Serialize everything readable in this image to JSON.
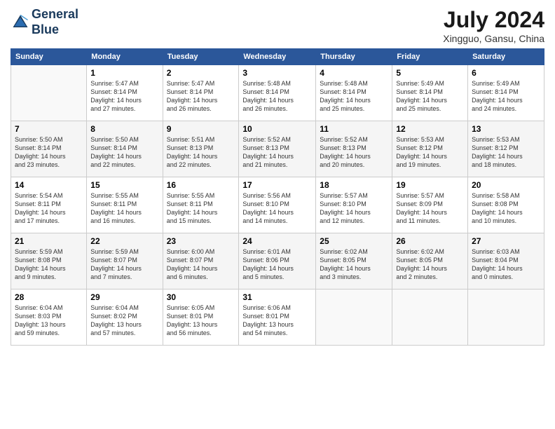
{
  "header": {
    "logo_line1": "General",
    "logo_line2": "Blue",
    "month_title": "July 2024",
    "location": "Xingguo, Gansu, China"
  },
  "weekdays": [
    "Sunday",
    "Monday",
    "Tuesday",
    "Wednesday",
    "Thursday",
    "Friday",
    "Saturday"
  ],
  "weeks": [
    [
      {
        "day": "",
        "info": ""
      },
      {
        "day": "1",
        "info": "Sunrise: 5:47 AM\nSunset: 8:14 PM\nDaylight: 14 hours\nand 27 minutes."
      },
      {
        "day": "2",
        "info": "Sunrise: 5:47 AM\nSunset: 8:14 PM\nDaylight: 14 hours\nand 26 minutes."
      },
      {
        "day": "3",
        "info": "Sunrise: 5:48 AM\nSunset: 8:14 PM\nDaylight: 14 hours\nand 26 minutes."
      },
      {
        "day": "4",
        "info": "Sunrise: 5:48 AM\nSunset: 8:14 PM\nDaylight: 14 hours\nand 25 minutes."
      },
      {
        "day": "5",
        "info": "Sunrise: 5:49 AM\nSunset: 8:14 PM\nDaylight: 14 hours\nand 25 minutes."
      },
      {
        "day": "6",
        "info": "Sunrise: 5:49 AM\nSunset: 8:14 PM\nDaylight: 14 hours\nand 24 minutes."
      }
    ],
    [
      {
        "day": "7",
        "info": "Sunrise: 5:50 AM\nSunset: 8:14 PM\nDaylight: 14 hours\nand 23 minutes."
      },
      {
        "day": "8",
        "info": "Sunrise: 5:50 AM\nSunset: 8:14 PM\nDaylight: 14 hours\nand 22 minutes."
      },
      {
        "day": "9",
        "info": "Sunrise: 5:51 AM\nSunset: 8:13 PM\nDaylight: 14 hours\nand 22 minutes."
      },
      {
        "day": "10",
        "info": "Sunrise: 5:52 AM\nSunset: 8:13 PM\nDaylight: 14 hours\nand 21 minutes."
      },
      {
        "day": "11",
        "info": "Sunrise: 5:52 AM\nSunset: 8:13 PM\nDaylight: 14 hours\nand 20 minutes."
      },
      {
        "day": "12",
        "info": "Sunrise: 5:53 AM\nSunset: 8:12 PM\nDaylight: 14 hours\nand 19 minutes."
      },
      {
        "day": "13",
        "info": "Sunrise: 5:53 AM\nSunset: 8:12 PM\nDaylight: 14 hours\nand 18 minutes."
      }
    ],
    [
      {
        "day": "14",
        "info": "Sunrise: 5:54 AM\nSunset: 8:11 PM\nDaylight: 14 hours\nand 17 minutes."
      },
      {
        "day": "15",
        "info": "Sunrise: 5:55 AM\nSunset: 8:11 PM\nDaylight: 14 hours\nand 16 minutes."
      },
      {
        "day": "16",
        "info": "Sunrise: 5:55 AM\nSunset: 8:11 PM\nDaylight: 14 hours\nand 15 minutes."
      },
      {
        "day": "17",
        "info": "Sunrise: 5:56 AM\nSunset: 8:10 PM\nDaylight: 14 hours\nand 14 minutes."
      },
      {
        "day": "18",
        "info": "Sunrise: 5:57 AM\nSunset: 8:10 PM\nDaylight: 14 hours\nand 12 minutes."
      },
      {
        "day": "19",
        "info": "Sunrise: 5:57 AM\nSunset: 8:09 PM\nDaylight: 14 hours\nand 11 minutes."
      },
      {
        "day": "20",
        "info": "Sunrise: 5:58 AM\nSunset: 8:08 PM\nDaylight: 14 hours\nand 10 minutes."
      }
    ],
    [
      {
        "day": "21",
        "info": "Sunrise: 5:59 AM\nSunset: 8:08 PM\nDaylight: 14 hours\nand 9 minutes."
      },
      {
        "day": "22",
        "info": "Sunrise: 5:59 AM\nSunset: 8:07 PM\nDaylight: 14 hours\nand 7 minutes."
      },
      {
        "day": "23",
        "info": "Sunrise: 6:00 AM\nSunset: 8:07 PM\nDaylight: 14 hours\nand 6 minutes."
      },
      {
        "day": "24",
        "info": "Sunrise: 6:01 AM\nSunset: 8:06 PM\nDaylight: 14 hours\nand 5 minutes."
      },
      {
        "day": "25",
        "info": "Sunrise: 6:02 AM\nSunset: 8:05 PM\nDaylight: 14 hours\nand 3 minutes."
      },
      {
        "day": "26",
        "info": "Sunrise: 6:02 AM\nSunset: 8:05 PM\nDaylight: 14 hours\nand 2 minutes."
      },
      {
        "day": "27",
        "info": "Sunrise: 6:03 AM\nSunset: 8:04 PM\nDaylight: 14 hours\nand 0 minutes."
      }
    ],
    [
      {
        "day": "28",
        "info": "Sunrise: 6:04 AM\nSunset: 8:03 PM\nDaylight: 13 hours\nand 59 minutes."
      },
      {
        "day": "29",
        "info": "Sunrise: 6:04 AM\nSunset: 8:02 PM\nDaylight: 13 hours\nand 57 minutes."
      },
      {
        "day": "30",
        "info": "Sunrise: 6:05 AM\nSunset: 8:01 PM\nDaylight: 13 hours\nand 56 minutes."
      },
      {
        "day": "31",
        "info": "Sunrise: 6:06 AM\nSunset: 8:01 PM\nDaylight: 13 hours\nand 54 minutes."
      },
      {
        "day": "",
        "info": ""
      },
      {
        "day": "",
        "info": ""
      },
      {
        "day": "",
        "info": ""
      }
    ]
  ]
}
